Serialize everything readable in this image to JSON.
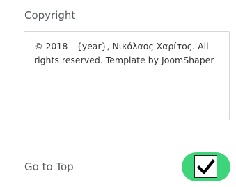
{
  "copyright": {
    "label": "Copyright",
    "value": "© 2018 - {year}, Νικόλαος Χαρίτος. All rights reserved. Template by JoomShaper"
  },
  "go_to_top": {
    "label": "Go to Top",
    "enabled": true,
    "toggle_color": "#3dd47a",
    "icon": "checkmark-icon"
  }
}
